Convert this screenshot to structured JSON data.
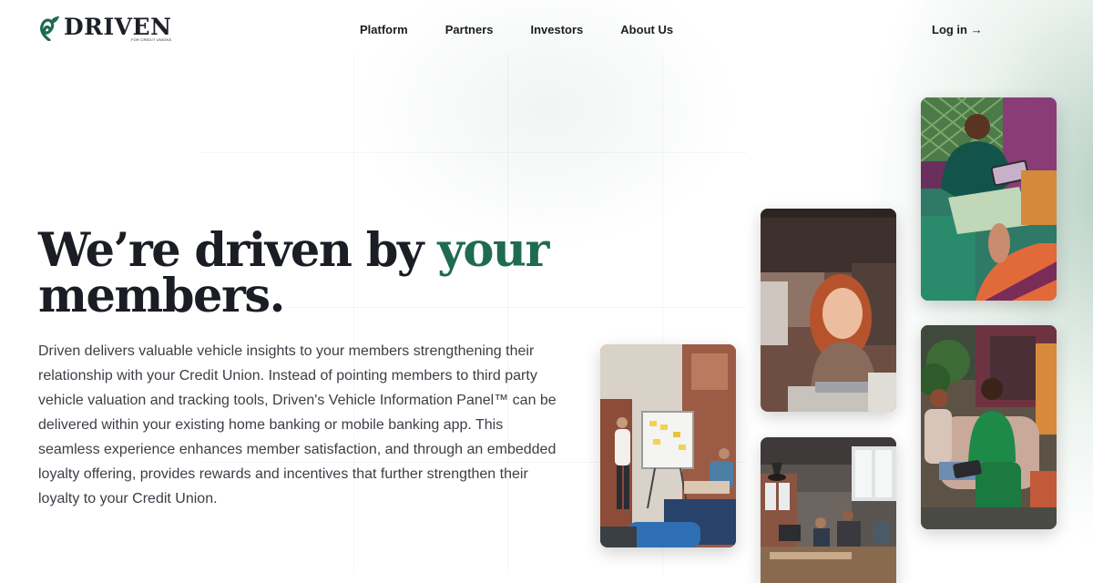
{
  "brand": {
    "name": "DRIVEN",
    "tagline": "FOR CREDIT UNIONS",
    "color": "#1f6b4f"
  },
  "nav": {
    "items": [
      {
        "label": "Platform"
      },
      {
        "label": "Partners"
      },
      {
        "label": "Investors"
      },
      {
        "label": "About Us"
      }
    ],
    "login_label": "Log in →"
  },
  "hero": {
    "title_part1": "We’re driven by ",
    "title_accent": "your",
    "title_part2": " members.",
    "description": "Driven delivers valuable vehicle insights to your members strengthening their relationship with your Credit Union. Instead of pointing members to third party vehicle valuation and tracking tools, Driven's Vehicle Information Panel™ can be delivered within your existing home banking or mobile banking app. This seamless experience enhances member satisfaction, and through an embedded loyalty offering, provides rewards and incentives that further strengthen their loyalty to your Credit Union."
  },
  "photos": [
    {
      "name": "team-whiteboard-meeting-photo"
    },
    {
      "name": "woman-on-laptop-photo"
    },
    {
      "name": "open-office-workspace-photo"
    },
    {
      "name": "man-with-tablet-photo"
    },
    {
      "name": "women-on-couch-photo"
    }
  ]
}
